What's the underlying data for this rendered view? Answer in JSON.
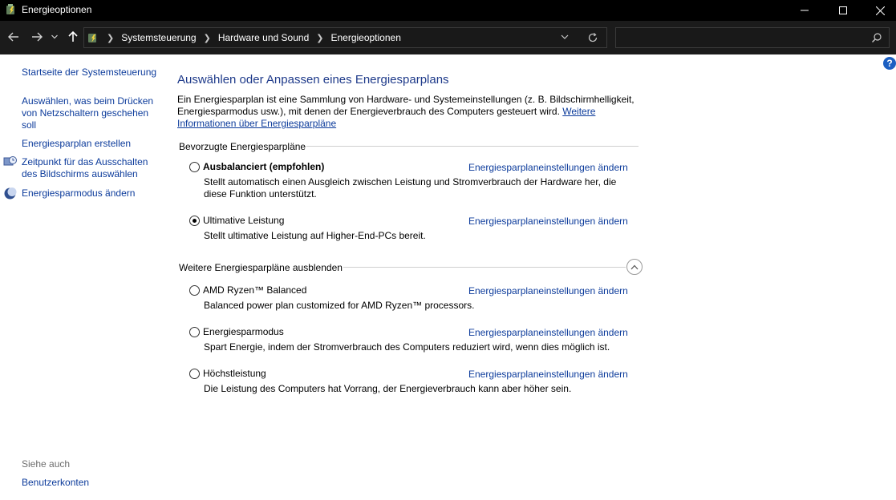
{
  "window": {
    "title": "Energieoptionen"
  },
  "address": {
    "crumbs": [
      "Systemsteuerung",
      "Hardware und Sound",
      "Energieoptionen"
    ],
    "search_placeholder": ""
  },
  "sidebar": {
    "home": "Startseite der Systemsteuerung",
    "links": [
      "Auswählen, was beim Drücken von Netzschaltern geschehen soll",
      "Energiesparplan erstellen",
      "Zeitpunkt für das Ausschalten des Bildschirms auswählen",
      "Energiesparmodus ändern"
    ],
    "see_also_label": "Siehe auch",
    "see_also_links": [
      "Benutzerkonten"
    ]
  },
  "main": {
    "title": "Auswählen oder Anpassen eines Energiesparplans",
    "intro_text": "Ein Energiesparplan ist eine Sammlung von Hardware- und Systemeinstellungen (z. B. Bildschirmhelligkeit, Energiesparmodus usw.), mit denen der Energieverbrauch des Computers gesteuert wird. ",
    "intro_link": "Weitere Informationen über Energiesparpläne",
    "preferred_heading": "Bevorzugte Energiesparpläne",
    "more_heading": "Weitere Energiesparpläne ausblenden",
    "change_link": "Energiesparplaneinstellungen ändern",
    "preferred_plans": [
      {
        "name": "Ausbalanciert (empfohlen)",
        "desc": "Stellt automatisch einen Ausgleich zwischen Leistung und Stromverbrauch der Hardware her, die diese Funktion unterstützt.",
        "selected": false,
        "bold": true
      },
      {
        "name": "Ultimative Leistung",
        "desc": "Stellt ultimative Leistung auf Higher-End-PCs bereit.",
        "selected": true,
        "bold": false
      }
    ],
    "more_plans": [
      {
        "name": "AMD Ryzen™ Balanced",
        "desc": "Balanced power plan customized for AMD Ryzen™ processors.",
        "selected": false
      },
      {
        "name": "Energiesparmodus",
        "desc": "Spart Energie, indem der Stromverbrauch des Computers reduziert wird, wenn dies möglich ist.",
        "selected": false
      },
      {
        "name": "Höchstleistung",
        "desc": "Die Leistung des Computers hat Vorrang, der Energieverbrauch kann aber höher sein.",
        "selected": false
      }
    ]
  }
}
